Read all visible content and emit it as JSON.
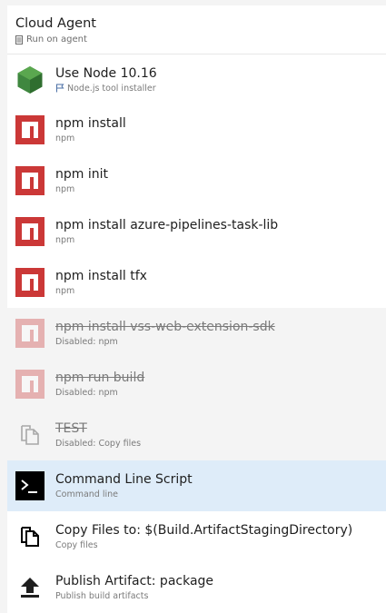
{
  "header": {
    "title": "Cloud Agent",
    "subtitle": "Run on agent",
    "icon": "server-icon"
  },
  "tasks": [
    {
      "title": "Use Node 10.16",
      "subtitle": "Node.js tool installer",
      "icon": "nodejs-icon",
      "state": "enabled"
    },
    {
      "title": "npm install",
      "subtitle": "npm",
      "icon": "npm-icon",
      "state": "enabled"
    },
    {
      "title": "npm init",
      "subtitle": "npm",
      "icon": "npm-icon",
      "state": "enabled"
    },
    {
      "title": "npm install azure-pipelines-task-lib",
      "subtitle": "npm",
      "icon": "npm-icon",
      "state": "enabled"
    },
    {
      "title": "npm install tfx",
      "subtitle": "npm",
      "icon": "npm-icon",
      "state": "enabled"
    },
    {
      "title": "npm install vss-web-extension-sdk",
      "subtitle": "Disabled: npm",
      "icon": "npm-icon",
      "state": "disabled"
    },
    {
      "title": "npm run build",
      "subtitle": "Disabled: npm",
      "icon": "npm-icon",
      "state": "disabled"
    },
    {
      "title": "TEST",
      "subtitle": "Disabled: Copy files",
      "icon": "copy-files-icon",
      "state": "disabled"
    },
    {
      "title": "Command Line Script",
      "subtitle": "Command line",
      "icon": "command-line-icon",
      "state": "selected"
    },
    {
      "title": "Copy Files to: $(Build.ArtifactStagingDirectory)",
      "subtitle": "Copy files",
      "icon": "copy-files-icon",
      "state": "enabled"
    },
    {
      "title": "Publish Artifact: package",
      "subtitle": "Publish build artifacts",
      "icon": "publish-artifact-icon",
      "state": "enabled"
    }
  ],
  "colors": {
    "npm_red": "#cb3837",
    "node_green": "#3f873f",
    "selected_bg": "#deecf9",
    "disabled_bg": "#f4f4f4"
  }
}
